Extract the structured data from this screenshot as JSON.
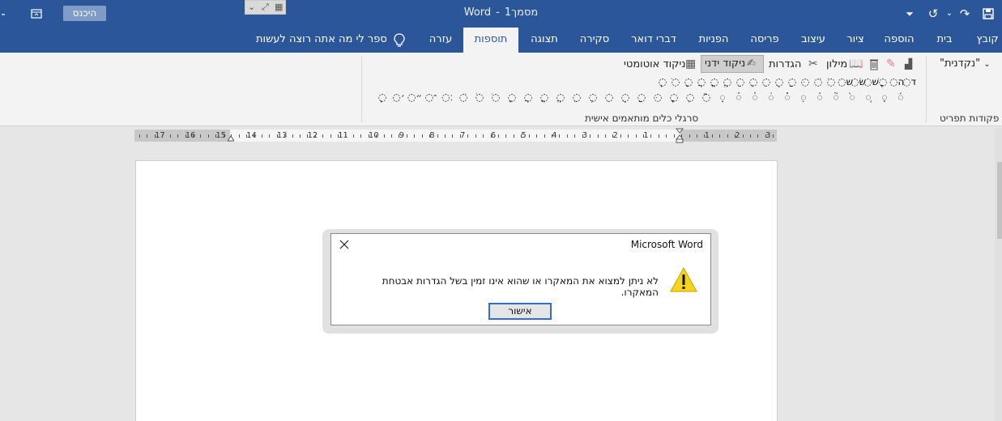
{
  "titlebar": {
    "doc_name": "מסמך1",
    "separator": "-",
    "app_name": "Word",
    "signin_label": "היכנס"
  },
  "tabs": [
    {
      "label": "קובץ"
    },
    {
      "label": "בית"
    },
    {
      "label": "הוספה"
    },
    {
      "label": "ציור"
    },
    {
      "label": "עיצוב"
    },
    {
      "label": "פריסה"
    },
    {
      "label": "הפניות"
    },
    {
      "label": "דברי דואר"
    },
    {
      "label": "סקירה"
    },
    {
      "label": "תצוגה"
    },
    {
      "label": "תוספות",
      "active": true
    },
    {
      "label": "עזרה"
    }
  ],
  "tell_me": "ספר לי מה אתה רוצה לעשות",
  "ribbon": {
    "font_name": "\"נקדנית\"",
    "menu_commands_label": "פקודות תפריט",
    "toolbar_group_label": "סרגלי כלים מותאמים אישית",
    "dictionary_label": "מילון",
    "settings_label": "הגדרות",
    "manual_nikud_label": "ניקוד ידני",
    "auto_nikud_label": "ניקוד אוטומטי"
  },
  "nikud_row1": [
    "ֽ",
    "ֹ",
    "ָ",
    "ֲ",
    "ֳ",
    "ֱ",
    "ֵ",
    "ֶ",
    "ִ",
    "ֻ",
    "ַ",
    "ּ",
    "ׁ",
    "ׂ",
    "ש",
    "שׂ",
    "שׁ",
    "ׇ",
    "ה",
    "ד"
  ],
  "nikud_row2": [
    "ֽ",
    "׳",
    "״",
    "־",
    "׃",
    "ׁ",
    "ׂ",
    "ֹ",
    "ָ",
    "ֲ",
    "ֳ",
    "ֱ",
    "ֵ",
    "ֶ",
    "ִ",
    "ֻ",
    "ַ",
    "ּ",
    "ׇ",
    "ְ",
    "ֿ",
    "֑",
    "֒",
    "֓",
    "֔",
    "֕",
    "֖",
    "֗",
    "֘",
    "֙",
    "֚",
    "֛",
    "֜"
  ],
  "ruler_numbers": [
    "17",
    "16",
    "15",
    "14",
    "13",
    "12",
    "11",
    "10",
    "9",
    "8",
    "7",
    "6",
    "5",
    "4",
    "3",
    "2",
    "1",
    "1",
    "2",
    "3"
  ],
  "dialog": {
    "title": "Microsoft Word",
    "message": "לא ניתן למצוא את המאקרו או שהוא אינו זמין בשל הגדרות אבטחת המאקרו.",
    "ok_label": "אישור"
  },
  "colors": {
    "accent": "#2b579a",
    "ribbon_bg": "#f3f3f3",
    "doc_bg": "#e6e6e6",
    "ok_border": "#2d6fd2",
    "warning_yellow": "#f8d31b"
  }
}
